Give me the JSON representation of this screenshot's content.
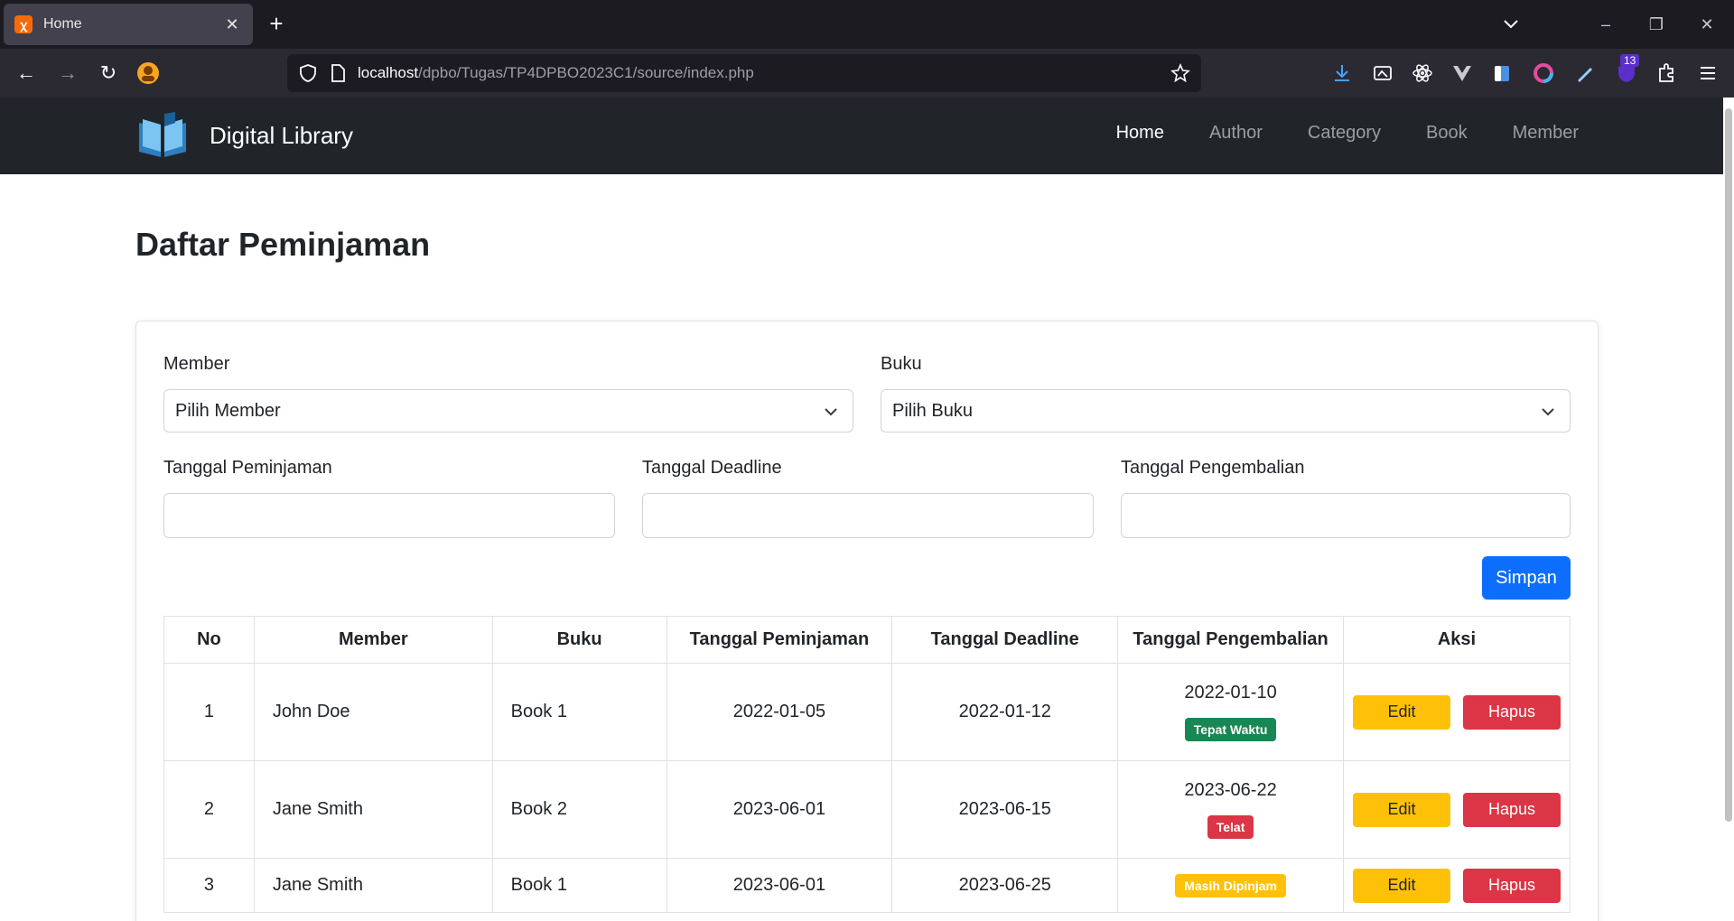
{
  "browser": {
    "tab_title": "Home",
    "url_host": "localhost",
    "url_path": "/dpbo/Tugas/TP4DPBO2023C1/source/index.php",
    "extension_badge": "13"
  },
  "site": {
    "brand": "Digital Library",
    "nav": [
      {
        "label": "Home",
        "active": true
      },
      {
        "label": "Author",
        "active": false
      },
      {
        "label": "Category",
        "active": false
      },
      {
        "label": "Book",
        "active": false
      },
      {
        "label": "Member",
        "active": false
      }
    ]
  },
  "main": {
    "title": "Daftar Peminjaman",
    "form": {
      "member_label": "Member",
      "member_value": "Pilih Member",
      "buku_label": "Buku",
      "buku_value": "Pilih Buku",
      "tgl_pinjam_label": "Tanggal Peminjaman",
      "tgl_deadline_label": "Tanggal Deadline",
      "tgl_kembali_label": "Tanggal Pengembalian",
      "submit_label": "Simpan"
    },
    "table": {
      "headers": [
        "No",
        "Member",
        "Buku",
        "Tanggal Peminjaman",
        "Tanggal Deadline",
        "Tanggal Pengembalian",
        "Aksi"
      ],
      "rows": [
        {
          "no": "1",
          "member": "John Doe",
          "buku": "Book 1",
          "pinjam": "2022-01-05",
          "deadline": "2022-01-12",
          "kembali": "2022-01-10",
          "status": "Tepat Waktu",
          "status_color": "#198754"
        },
        {
          "no": "2",
          "member": "Jane Smith",
          "buku": "Book 2",
          "pinjam": "2023-06-01",
          "deadline": "2023-06-15",
          "kembali": "2023-06-22",
          "status": "Telat",
          "status_color": "#dc3545"
        },
        {
          "no": "3",
          "member": "Jane Smith",
          "buku": "Book 1",
          "pinjam": "2023-06-01",
          "deadline": "2023-06-25",
          "kembali": "",
          "status": "Masih Dipinjam",
          "status_color": "#ffc107"
        }
      ],
      "edit_label": "Edit",
      "delete_label": "Hapus"
    }
  }
}
